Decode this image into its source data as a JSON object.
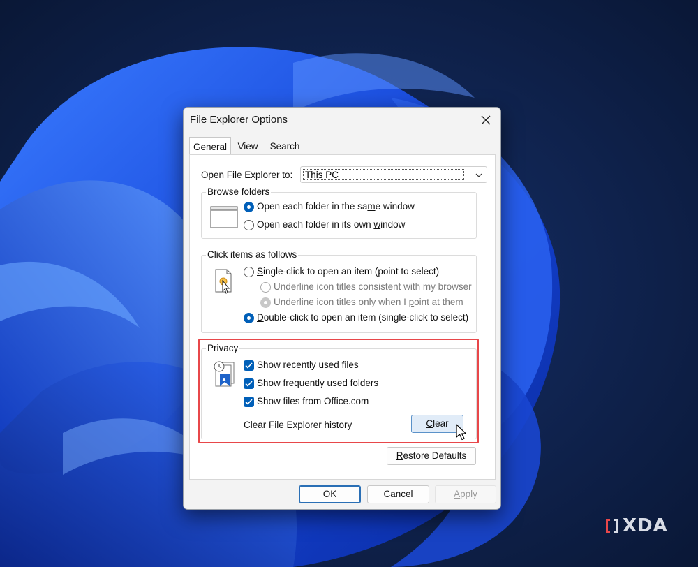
{
  "dialog": {
    "title": "File Explorer Options",
    "tabs": [
      {
        "label": "General",
        "active": true
      },
      {
        "label": "View",
        "active": false
      },
      {
        "label": "Search",
        "active": false
      }
    ]
  },
  "general": {
    "open_to_label": "Open File Explorer to:",
    "open_to_value": "This PC",
    "browse_folders": {
      "title": "Browse folders",
      "option_same": {
        "pre": "Open each folder in the sa",
        "u": "m",
        "post": "e window"
      },
      "option_own": {
        "pre": "Open each folder in its own ",
        "u": "w",
        "post": "indow"
      }
    },
    "click_items": {
      "title": "Click items as follows",
      "single": {
        "pre": "",
        "u": "S",
        "post": "ingle-click to open an item (point to select)"
      },
      "underline_browser": "Underline icon titles consistent with my browser",
      "underline_point": {
        "pre": "Underline icon titles only when I ",
        "u": "p",
        "post": "oint at them"
      },
      "double": {
        "pre": "",
        "u": "D",
        "post": "ouble-click to open an item (single-click to select)"
      }
    },
    "privacy": {
      "title": "Privacy",
      "recent_files": "Show recently used files",
      "frequent_folders": "Show frequently used folders",
      "office_files": "Show files from Office.com",
      "clear_history_label": "Clear File Explorer history",
      "clear_button": {
        "pre": "",
        "u": "C",
        "post": "lear"
      }
    },
    "restore_defaults": {
      "pre": "",
      "u": "R",
      "post": "estore Defaults"
    }
  },
  "footer": {
    "ok": "OK",
    "cancel": "Cancel",
    "apply": {
      "pre": "",
      "u": "A",
      "post": "pply"
    }
  },
  "watermark": "XDA",
  "colors": {
    "accent": "#005fb8",
    "highlight": "#e8474a",
    "wallpaper_bg": "#0b1a3c",
    "wallpaper_bloom": "#1f56e6"
  }
}
